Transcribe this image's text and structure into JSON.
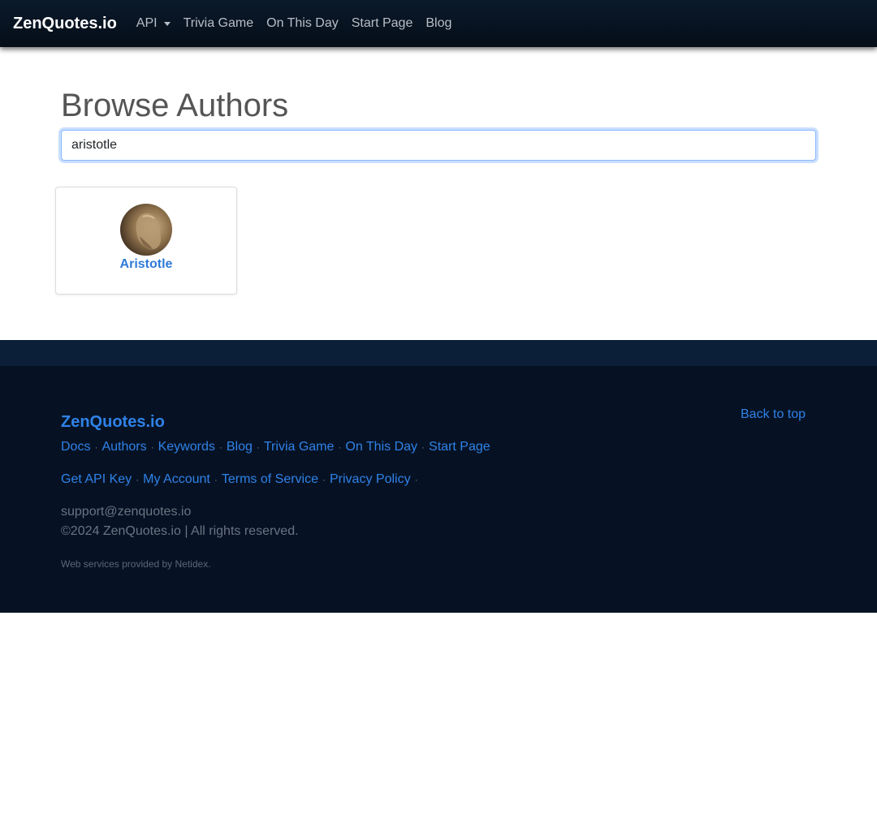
{
  "nav": {
    "brand": "ZenQuotes.io",
    "items": [
      {
        "label": "API",
        "dropdown": true
      },
      {
        "label": "Trivia Game"
      },
      {
        "label": "On This Day"
      },
      {
        "label": "Start Page"
      },
      {
        "label": "Blog"
      }
    ]
  },
  "main": {
    "title": "Browse Authors",
    "search": {
      "value": "aristotle"
    },
    "results": [
      {
        "name": "Aristotle"
      }
    ]
  },
  "footer": {
    "brand": "ZenQuotes.io",
    "back_to_top": "Back to top",
    "links_row1": [
      "Docs",
      "Authors",
      "Keywords",
      "Blog",
      "Trivia Game",
      "On This Day",
      "Start Page"
    ],
    "links_row2": [
      "Get API Key",
      "My Account",
      "Terms of Service",
      "Privacy Policy"
    ],
    "separator": "·",
    "support_email": "support@zenquotes.io",
    "copyright": "©2024 ZenQuotes.io | All rights reserved.",
    "provided_by": "Web services provided by Netidex."
  }
}
